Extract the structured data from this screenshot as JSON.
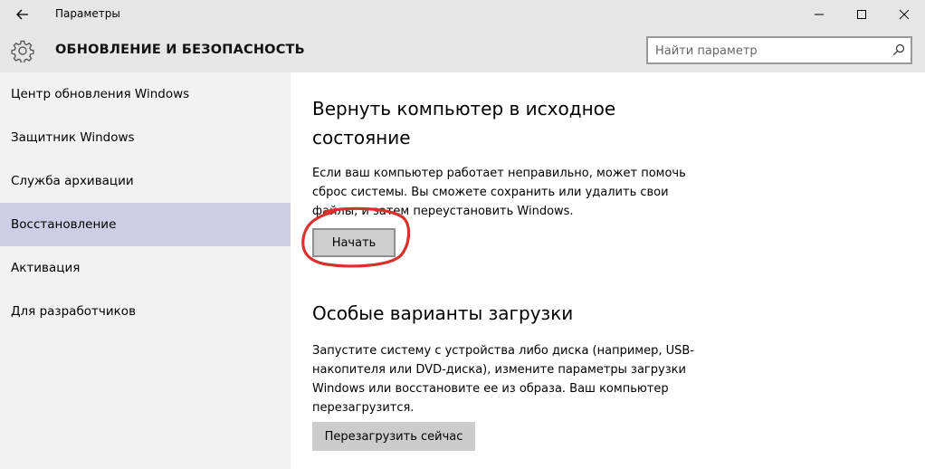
{
  "window": {
    "title": "Параметры"
  },
  "header": {
    "section_title": "ОБНОВЛЕНИЕ И БЕЗОПАСНОСТЬ",
    "search_placeholder": "Найти параметр"
  },
  "sidebar": {
    "items": [
      {
        "label": "Центр обновления Windows",
        "active": false
      },
      {
        "label": "Защитник Windows",
        "active": false
      },
      {
        "label": "Служба архивации",
        "active": false
      },
      {
        "label": "Восстановление",
        "active": true
      },
      {
        "label": "Активация",
        "active": false
      },
      {
        "label": "Для разработчиков",
        "active": false
      }
    ]
  },
  "reset": {
    "title": "Вернуть компьютер в исходное состояние",
    "description": "Если ваш компьютер работает неправильно, может помочь сброс системы. Вы сможете сохранить или удалить свои файлы, и затем переустановить Windows.",
    "button_label": "Начать"
  },
  "advanced": {
    "title": "Особые варианты загрузки",
    "description": "Запустите систему с устройства либо диска (например, USB-накопителя или DVD-диска), измените параметры загрузки Windows или восстановите ее из образа. Ваш компьютер перезагрузится.",
    "button_label": "Перезагрузить сейчас"
  },
  "colors": {
    "chrome": "#e6e6e6",
    "sidebar": "#f2f2f2",
    "active_item": "#cfcde6",
    "button": "#cccccc",
    "annotation": "#d9302b"
  }
}
